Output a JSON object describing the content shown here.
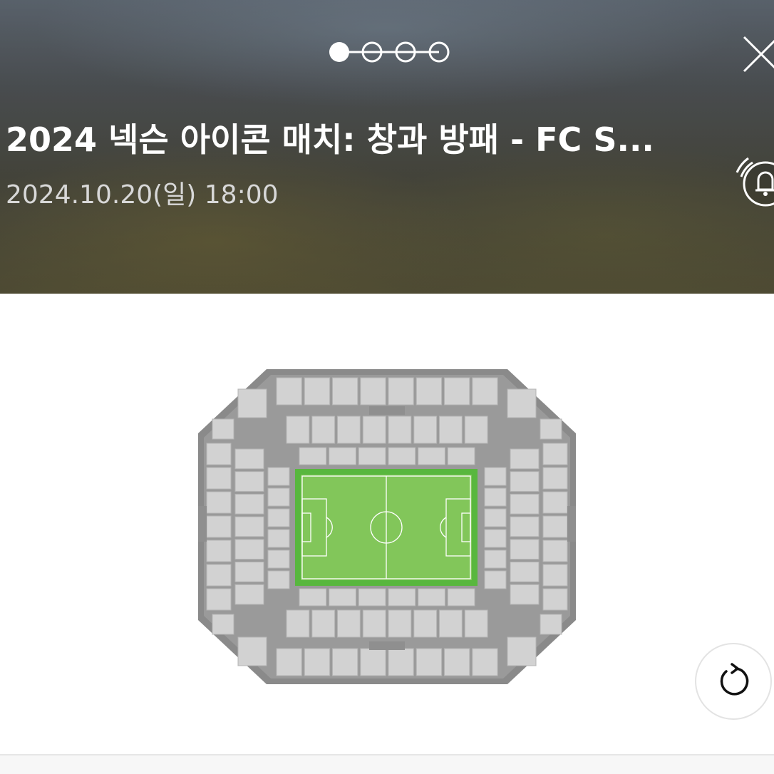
{
  "header": {
    "title": "2024 넥슨 아이콘 매치: 창과 방패 - FC S...",
    "date": "2024.10.20(일) 18:00"
  },
  "pager": {
    "total": 4,
    "active_index": 0
  },
  "icons": {
    "close": "close-icon",
    "bell": "bell-icon",
    "refresh": "refresh-icon"
  },
  "colors": {
    "pitch": "#82c65a",
    "pitch_border": "#58b73e",
    "seats": "#d2d2d2",
    "stadium": "#8a8a8a"
  }
}
